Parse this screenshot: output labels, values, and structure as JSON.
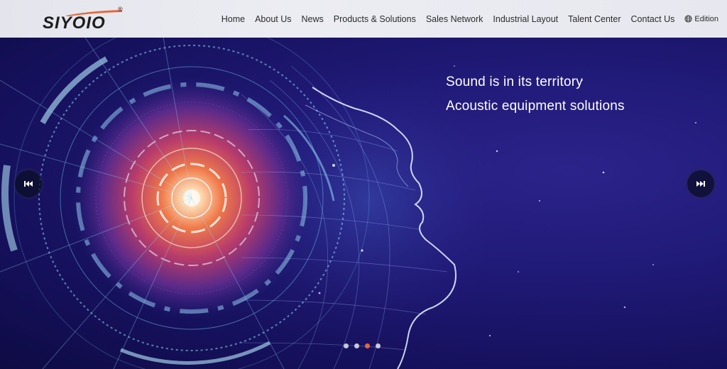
{
  "brand": {
    "logo_text": "SIYOIO",
    "registered_mark": "®",
    "swoosh_color": "#e8663a"
  },
  "nav": {
    "items": [
      {
        "label": "Home"
      },
      {
        "label": "About Us"
      },
      {
        "label": "News"
      },
      {
        "label": "Products & Solutions"
      },
      {
        "label": "Sales Network"
      },
      {
        "label": "Industrial Layout"
      },
      {
        "label": "Talent Center"
      },
      {
        "label": "Contact Us"
      }
    ],
    "edition_label": "Edition",
    "edition_icon": "globe-icon"
  },
  "hero": {
    "slogan_line1": "Sound is in its territory",
    "slogan_line2": "Acoustic equipment solutions",
    "prev_icon": "skip-previous-icon",
    "next_icon": "skip-next-icon",
    "slide_count": 4,
    "active_slide_index": 2,
    "background_color": "#1a1560",
    "active_dot_color": "#e8663a"
  }
}
